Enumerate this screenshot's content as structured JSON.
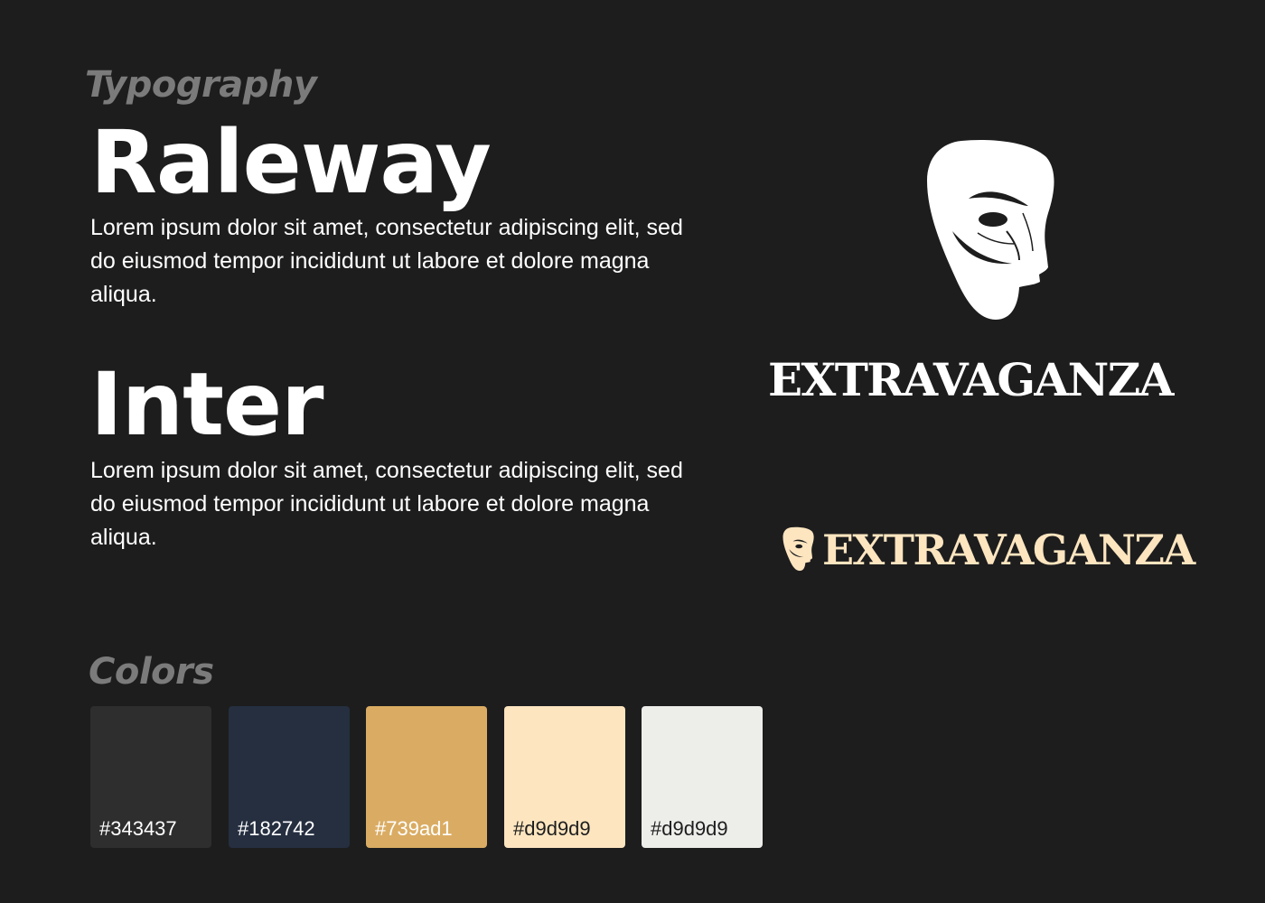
{
  "typography": {
    "heading": "Typography",
    "fonts": [
      {
        "name": "Raleway",
        "sample": "Lorem ipsum dolor sit amet, consectetur adipiscing elit, sed do eiusmod tempor incididunt ut labore et dolore magna aliqua."
      },
      {
        "name": "Inter",
        "sample": "Lorem ipsum dolor sit amet, consectetur adipiscing elit, sed do eiusmod tempor incididunt ut labore et dolore magna aliqua."
      }
    ]
  },
  "logos": {
    "large": {
      "icon": "theater-mask-icon",
      "wordmark": "EXTRAVAGANZA",
      "color": "#ffffff"
    },
    "small": {
      "icon": "theater-mask-icon",
      "wordmark": "EXTRAVAGANZA",
      "color": "#fde5bf"
    }
  },
  "colors": {
    "heading": "Colors",
    "swatches": [
      {
        "label": "#343437",
        "fill": "#2e2e2f",
        "text_color": "#ffffff"
      },
      {
        "label": "#182742",
        "fill": "#252f40",
        "text_color": "#ffffff"
      },
      {
        "label": "#739ad1",
        "fill": "#daac63",
        "text_color": "#ffffff"
      },
      {
        "label": "#d9d9d9",
        "fill": "#fde5bf",
        "text_color": "#1d1d1e"
      },
      {
        "label": "#d9d9d9",
        "fill": "#edeeea",
        "text_color": "#1d1d1e"
      }
    ]
  }
}
